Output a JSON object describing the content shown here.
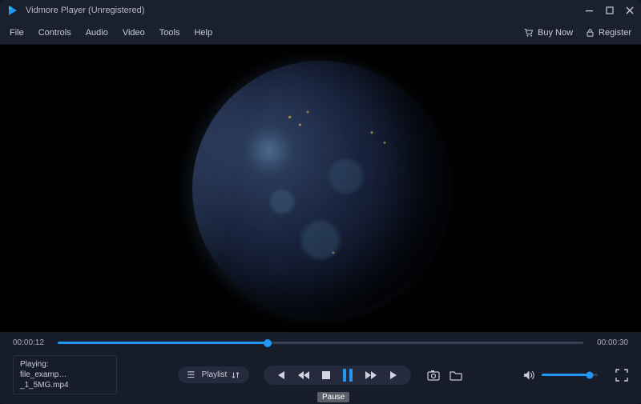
{
  "window": {
    "title": "Vidmore Player (Unregistered)"
  },
  "menu": {
    "items": [
      "File",
      "Controls",
      "Audio",
      "Video",
      "Tools",
      "Help"
    ],
    "buy": "Buy Now",
    "register": "Register"
  },
  "playback": {
    "current_time": "00:00:12",
    "total_time": "00:00:30",
    "progress_percent": 40
  },
  "status": {
    "label": "Playing:",
    "filename": "file_examp…_1_5MG.mp4"
  },
  "playlist_btn": "Playlist",
  "tooltip": "Pause",
  "volume": {
    "percent": 85
  },
  "colors": {
    "accent": "#2196f3"
  }
}
